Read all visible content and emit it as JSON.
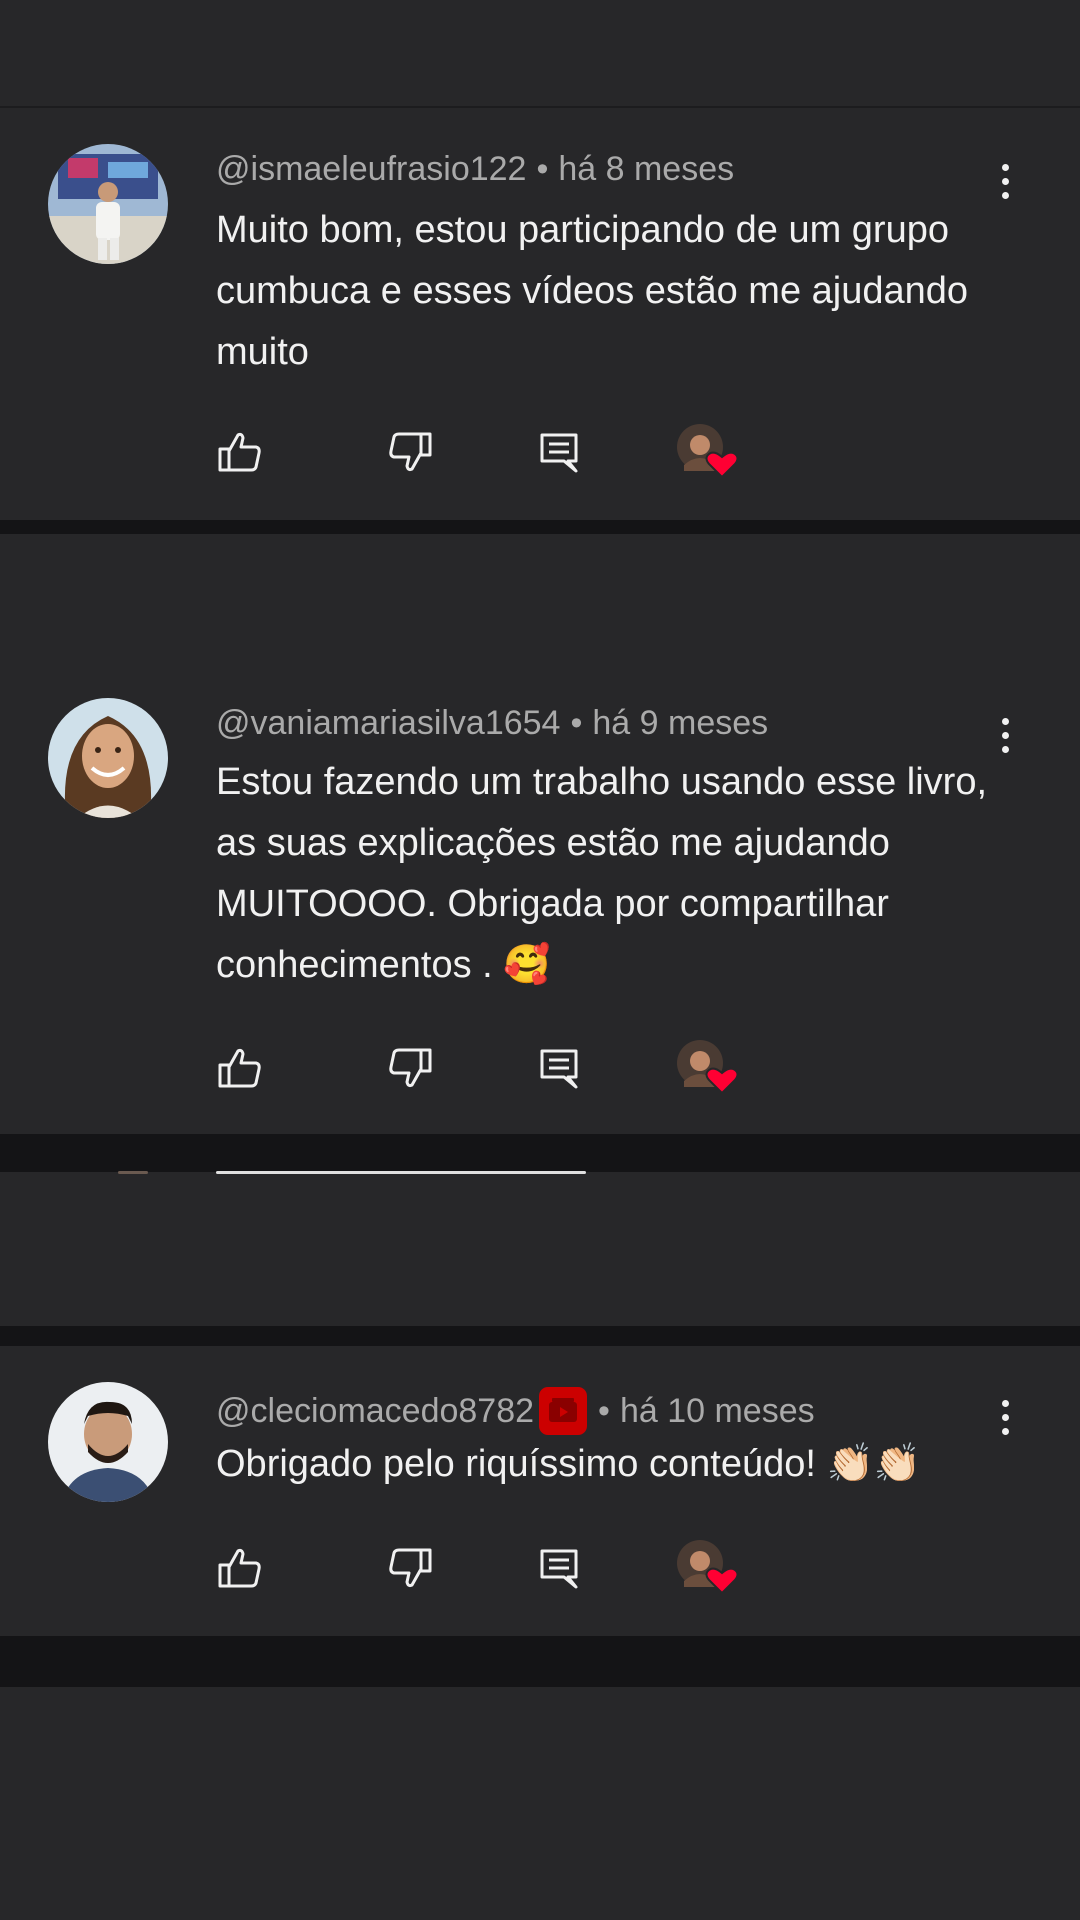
{
  "comments": [
    {
      "author": "@ismaeleufrasio122",
      "separator": "•",
      "time": "há 8 meses",
      "text": "Muito bom, estou participando de um grupo cumbuca e esses vídeos estão me ajudando muito",
      "avatar": "avatar-man-outdoor",
      "has_channel_badge": false
    },
    {
      "author": "@vaniamariasilva1654",
      "separator": "•",
      "time": "há 9 meses",
      "text": "Estou fazendo um trabalho usando esse livro,  as suas explicações estão me ajudando MUITOOOO.  Obrigada por compartilhar conhecimentos . 🥰",
      "avatar": "avatar-woman-smiling",
      "has_channel_badge": false
    },
    {
      "author": "@cleciomacedo8782",
      "separator": "•",
      "time": "há 10 meses",
      "text": "Obrigado pelo riquíssimo conteúdo! 👏🏻👏🏻",
      "avatar": "avatar-man-portrait",
      "has_channel_badge": true
    }
  ],
  "icons": {
    "like": "thumbs-up-icon",
    "dislike": "thumbs-down-icon",
    "reply": "reply-icon",
    "creator_heart": "creator-heart-icon",
    "more": "more-vert-icon",
    "badge": "youtube-member-badge-icon"
  },
  "colors": {
    "background": "#272729",
    "divider": "#141416",
    "meta_text": "#aaaaaa",
    "body_text": "#f1f1f1",
    "heart": "#ff0033",
    "badge": "#cc0000"
  }
}
